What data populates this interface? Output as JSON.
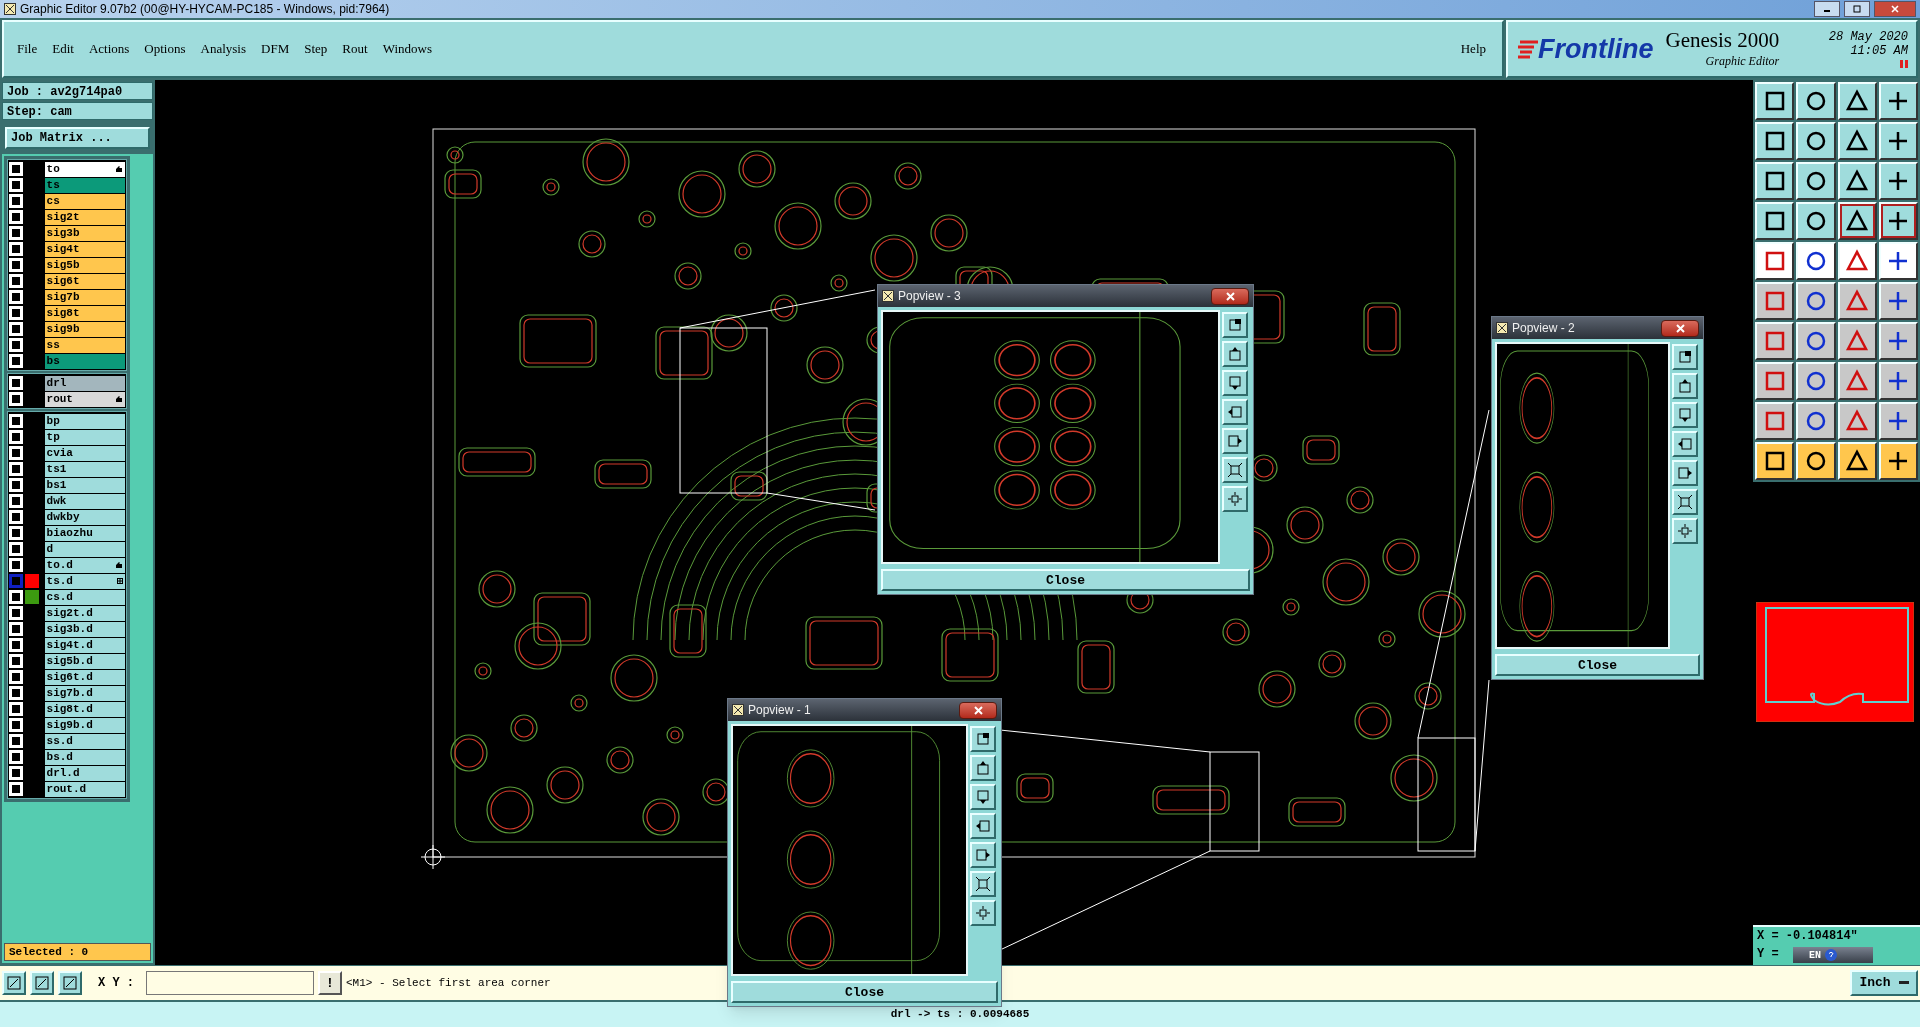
{
  "window": {
    "title": "Graphic Editor 9.07b2 (00@HY-HYCAM-PC185 - Windows, pid:7964)"
  },
  "menu": [
    "File",
    "Edit",
    "Actions",
    "Options",
    "Analysis",
    "DFM",
    "Step",
    "Rout",
    "Windows"
  ],
  "help": "Help",
  "brand": {
    "logo": "Frontline",
    "product": "Genesis 2000",
    "subtitle": "Graphic Editor",
    "date": "28 May 2020",
    "time": "11:05 AM"
  },
  "job": {
    "job": "Job : av2g714pa0",
    "step": "Step: cam",
    "matrix_button": "Job Matrix ..."
  },
  "layer_groups": [
    [
      {
        "name": "to",
        "kind": "work",
        "pinned": true,
        "grid": false,
        "selected": false
      },
      {
        "name": "ts",
        "kind": "mask",
        "pinned": false,
        "grid": false,
        "selected": false
      },
      {
        "name": "cs",
        "kind": "signal",
        "pinned": false,
        "grid": false,
        "selected": false
      },
      {
        "name": "sig2t",
        "kind": "signal",
        "pinned": false,
        "grid": false,
        "selected": false
      },
      {
        "name": "sig3b",
        "kind": "signal",
        "pinned": false,
        "grid": false,
        "selected": false
      },
      {
        "name": "sig4t",
        "kind": "signal",
        "pinned": false,
        "grid": false,
        "selected": false
      },
      {
        "name": "sig5b",
        "kind": "signal",
        "pinned": false,
        "grid": false,
        "selected": false
      },
      {
        "name": "sig6t",
        "kind": "signal",
        "pinned": false,
        "grid": false,
        "selected": false
      },
      {
        "name": "sig7b",
        "kind": "signal",
        "pinned": false,
        "grid": false,
        "selected": false
      },
      {
        "name": "sig8t",
        "kind": "signal",
        "pinned": false,
        "grid": false,
        "selected": false
      },
      {
        "name": "sig9b",
        "kind": "signal",
        "pinned": false,
        "grid": false,
        "selected": false
      },
      {
        "name": "ss",
        "kind": "signal",
        "pinned": false,
        "grid": false,
        "selected": false
      },
      {
        "name": "bs",
        "kind": "mask",
        "pinned": false,
        "grid": false,
        "selected": false
      }
    ],
    [
      {
        "name": "drl",
        "kind": "drill",
        "pinned": false,
        "grid": false,
        "selected": false
      },
      {
        "name": "rout",
        "kind": "rout",
        "pinned": true,
        "grid": false,
        "selected": false
      }
    ],
    [
      {
        "name": "bp",
        "kind": "misc",
        "pinned": false,
        "grid": false,
        "selected": false
      },
      {
        "name": "tp",
        "kind": "misc",
        "pinned": false,
        "grid": false,
        "selected": false
      },
      {
        "name": "cvia",
        "kind": "misc",
        "pinned": false,
        "grid": false,
        "selected": false
      },
      {
        "name": "ts1",
        "kind": "misc",
        "pinned": false,
        "grid": false,
        "selected": false
      },
      {
        "name": "bs1",
        "kind": "misc",
        "pinned": false,
        "grid": false,
        "selected": false
      },
      {
        "name": "dwk",
        "kind": "misc",
        "pinned": false,
        "grid": false,
        "selected": false
      },
      {
        "name": "dwkby",
        "kind": "misc",
        "pinned": false,
        "grid": false,
        "selected": false
      },
      {
        "name": "biaozhu",
        "kind": "misc",
        "pinned": false,
        "grid": false,
        "selected": false
      },
      {
        "name": "d",
        "kind": "misc",
        "pinned": false,
        "grid": false,
        "selected": false
      },
      {
        "name": "to.d",
        "kind": "misc",
        "pinned": true,
        "grid": false,
        "selected": false
      },
      {
        "name": "ts.d",
        "kind": "misc",
        "color": "#ff0000",
        "pinned": false,
        "grid": true,
        "selected": true
      },
      {
        "name": "cs.d",
        "kind": "misc",
        "color": "#3c9a10",
        "pinned": false,
        "grid": false,
        "selected": false
      },
      {
        "name": "sig2t.d",
        "kind": "misc",
        "pinned": false,
        "grid": false,
        "selected": false
      },
      {
        "name": "sig3b.d",
        "kind": "misc",
        "pinned": false,
        "grid": false,
        "selected": false
      },
      {
        "name": "sig4t.d",
        "kind": "misc",
        "pinned": false,
        "grid": false,
        "selected": false
      },
      {
        "name": "sig5b.d",
        "kind": "misc",
        "pinned": false,
        "grid": false,
        "selected": false
      },
      {
        "name": "sig6t.d",
        "kind": "misc",
        "pinned": false,
        "grid": false,
        "selected": false
      },
      {
        "name": "sig7b.d",
        "kind": "misc",
        "pinned": false,
        "grid": false,
        "selected": false
      },
      {
        "name": "sig8t.d",
        "kind": "misc",
        "pinned": false,
        "grid": false,
        "selected": false
      },
      {
        "name": "sig9b.d",
        "kind": "misc",
        "pinned": false,
        "grid": false,
        "selected": false
      },
      {
        "name": "ss.d",
        "kind": "misc",
        "pinned": false,
        "grid": false,
        "selected": false
      },
      {
        "name": "bs.d",
        "kind": "misc",
        "pinned": false,
        "grid": false,
        "selected": false
      },
      {
        "name": "drl.d",
        "kind": "misc",
        "pinned": false,
        "grid": false,
        "selected": false
      },
      {
        "name": "rout.d",
        "kind": "misc",
        "pinned": false,
        "grid": false,
        "selected": false
      }
    ]
  ],
  "selected_count": "Selected : 0",
  "popviews": [
    {
      "title": "Popview - 3",
      "close_button": "Close"
    },
    {
      "title": "Popview - 2",
      "close_button": "Close"
    },
    {
      "title": "Popview - 1",
      "close_button": "Close"
    }
  ],
  "coords": {
    "x": "X = -0.104814\"",
    "y": "Y ="
  },
  "ime": {
    "label": "EN"
  },
  "command": {
    "label": "X Y :",
    "bang": "!",
    "prompt": "<M1> - Select first area corner",
    "units": "Inch"
  },
  "status": "drl -> ts : 0.0094685"
}
